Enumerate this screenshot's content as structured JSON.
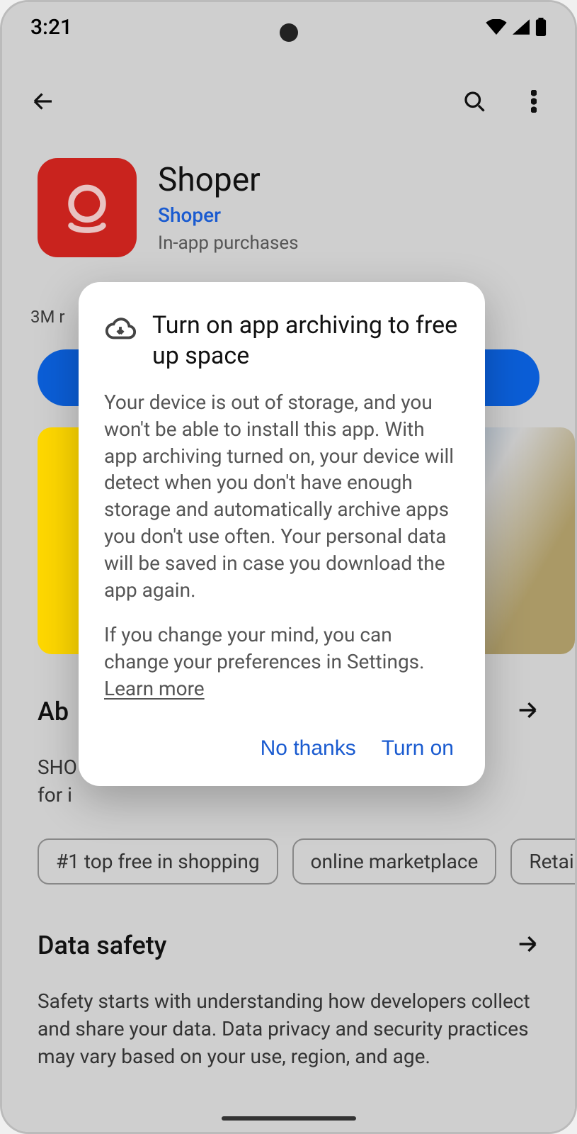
{
  "status_bar": {
    "time": "3:21"
  },
  "app": {
    "title": "Shoper",
    "developer": "Shoper",
    "iap_label": "In-app purchases",
    "reviews_hint": "3M r"
  },
  "sections": {
    "about_title": "Ab",
    "about_text_1": "SHO",
    "about_text_2": "for i",
    "safety_title": "Data safety",
    "safety_text": "Safety starts with understanding how developers collect and share your data. Data privacy and security practices may vary based on your use, region, and age."
  },
  "chips": {
    "item0": "#1 top free in shopping",
    "item1": "online marketplace",
    "item2": "Retai"
  },
  "dialog": {
    "title": "Turn on app archiving to free up space",
    "body_p1": "Your device is out of storage, and you won't be able to install this app. With app archiving turned on, your device will detect when you don't have enough storage and automatically archive apps you don't use often. Your personal data will be saved in case you download the app again.",
    "body_p2": "If you change your mind, you can change your preferences in Settings.",
    "learn_more": "Learn more",
    "no_thanks": "No thanks",
    "turn_on": "Turn on"
  }
}
